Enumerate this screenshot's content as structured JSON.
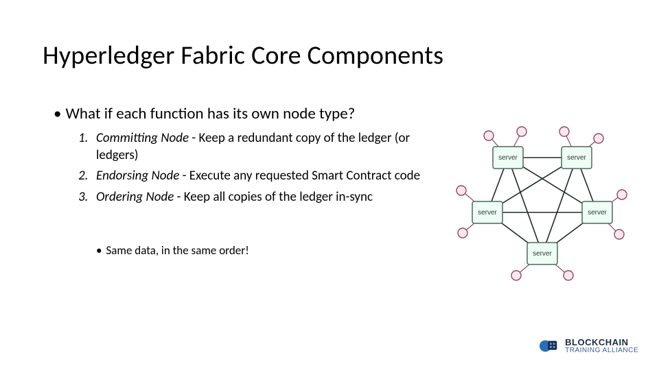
{
  "title": "Hyperledger Fabric Core Components",
  "lead": "What if each function has its own node type?",
  "items": [
    {
      "num": "1.",
      "name": "Committing Node",
      "desc": " - Keep a redundant copy of the ledger (or ledgers)"
    },
    {
      "num": "2.",
      "name": "Endorsing Node",
      "desc": " - Execute any requested Smart Contract code"
    },
    {
      "num": "3.",
      "name": "Ordering Node",
      "desc": " - Keep all copies of the ledger in-sync"
    }
  ],
  "sub": "Same data, in the same order!",
  "diagram": {
    "server_label": "server"
  },
  "logo": {
    "line1": "BLOCKCHAIN",
    "line2": "TRAINING ALLIANCE"
  }
}
